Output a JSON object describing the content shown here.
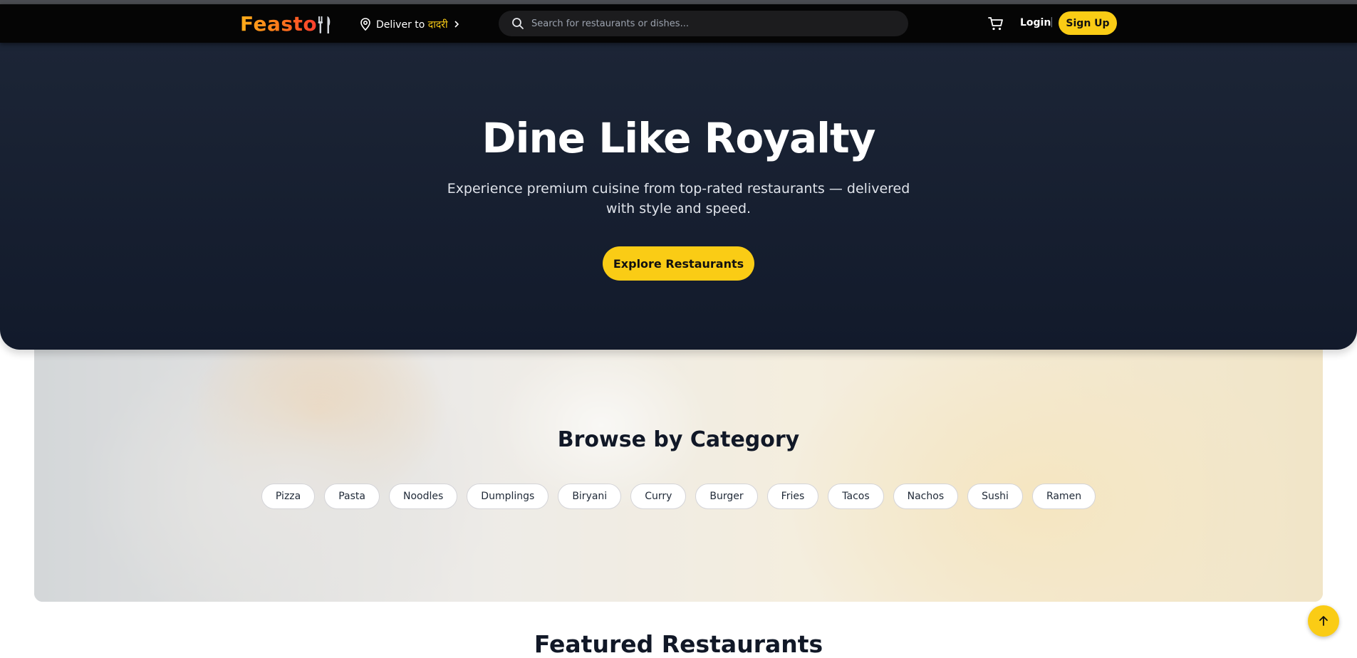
{
  "nav": {
    "logo": "Feasto",
    "deliver_label": "Deliver to",
    "deliver_city": "दादरी",
    "search_placeholder": "Search for restaurants or dishes...",
    "login": "Login",
    "separator": "|",
    "signup": "Sign Up"
  },
  "hero": {
    "title": "Dine Like Royalty",
    "subtitle": "Experience premium cuisine from top-rated restaurants — delivered with style and speed.",
    "cta": "Explore Restaurants"
  },
  "categories": {
    "title": "Browse by Category",
    "items": [
      "Pizza",
      "Pasta",
      "Noodles",
      "Dumplings",
      "Biryani",
      "Curry",
      "Burger",
      "Fries",
      "Tacos",
      "Nachos",
      "Sushi",
      "Ramen"
    ]
  },
  "featured": {
    "title": "Featured Restaurants"
  },
  "colors": {
    "accent": "#facc15",
    "hero_bg": "#1c2536",
    "navbar_bg": "#050505"
  },
  "icons": [
    "fork-knife-icon",
    "location-pin-icon",
    "chevron-right-icon",
    "search-icon",
    "cart-icon",
    "arrow-up-icon"
  ]
}
